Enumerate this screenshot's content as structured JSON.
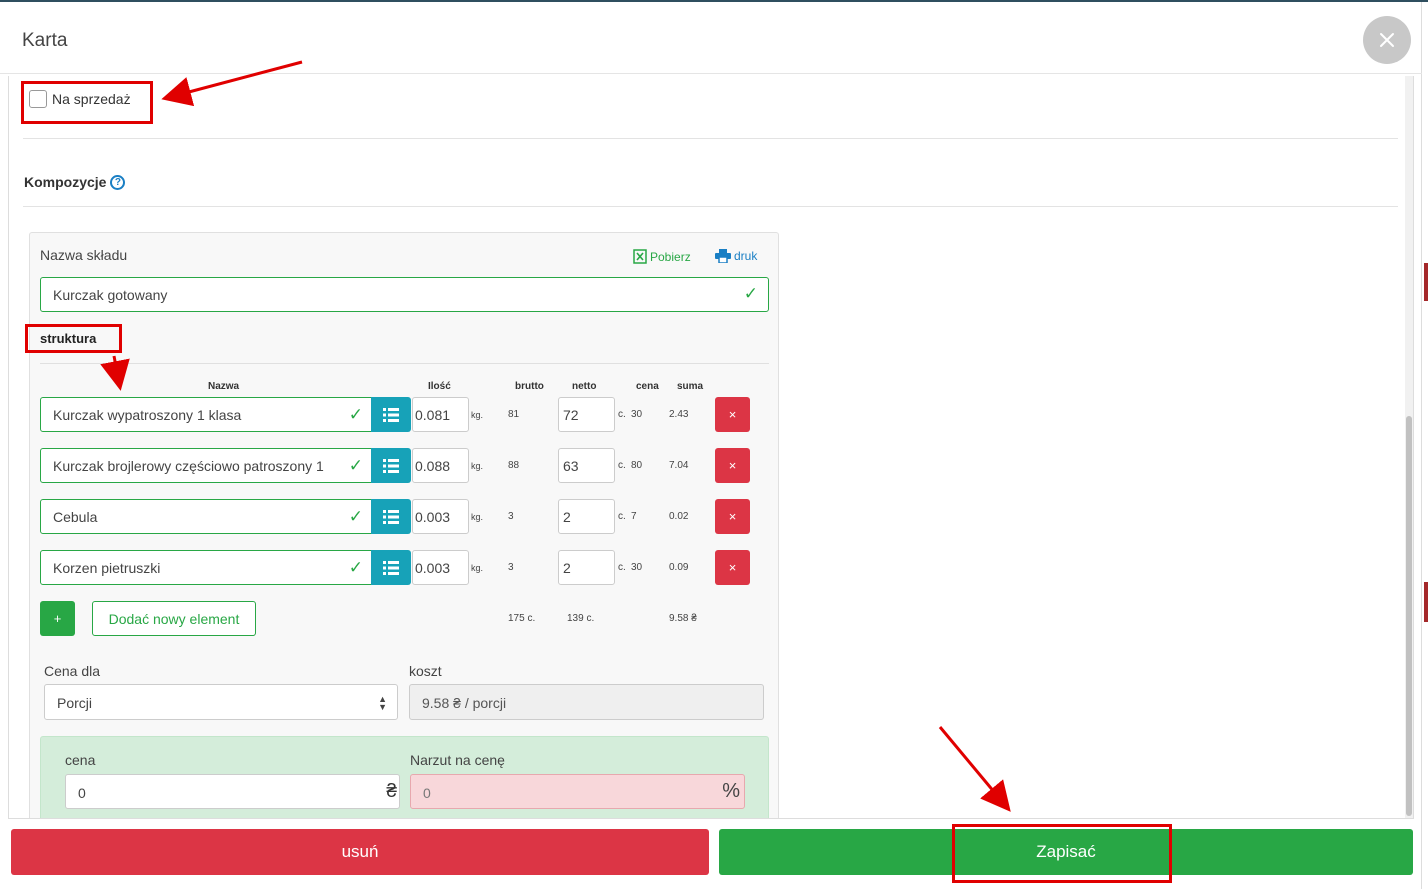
{
  "modal": {
    "title": "Karta"
  },
  "sale": {
    "label": "Na sprzedaż"
  },
  "composition": {
    "title": "Kompozycje",
    "help": "?",
    "name_label": "Nazwa składu",
    "download": "Pobierz",
    "print": "druk",
    "name_value": "Kurczak gotowany",
    "structure_label": "struktura",
    "columns": {
      "name": "Nazwa",
      "qty": "Ilość",
      "brutto": "brutto",
      "netto": "netto",
      "price": "cena",
      "sum": "suma"
    },
    "rows": [
      {
        "name": "Kurczak wypatroszony 1 klasa",
        "qty": "0.081",
        "unit": "kg.",
        "brutto": "81",
        "netto": "72",
        "netto_unit": "с.",
        "price": "30",
        "sum": "2.43"
      },
      {
        "name": "Kurczak brojlerowy częściowo patroszony 1",
        "qty": "0.088",
        "unit": "kg.",
        "brutto": "88",
        "netto": "63",
        "netto_unit": "с.",
        "price": "80",
        "sum": "7.04"
      },
      {
        "name": "Cebula",
        "qty": "0.003",
        "unit": "kg.",
        "brutto": "3",
        "netto": "2",
        "netto_unit": "с.",
        "price": "7",
        "sum": "0.02"
      },
      {
        "name": "Korzen pietruszki",
        "qty": "0.003",
        "unit": "kg.",
        "brutto": "3",
        "netto": "2",
        "netto_unit": "с.",
        "price": "30",
        "sum": "0.09"
      }
    ],
    "add_plus": "+",
    "add_new": "Dodać nowy element",
    "totals": {
      "brutto": "175 с.",
      "netto": "139 с.",
      "sum": "9.58 ₴"
    },
    "price_for_label": "Cena dla",
    "price_for_value": "Porcji",
    "cost_label": "koszt",
    "cost_value": "9.58 ₴ / porcji",
    "price_label": "cena",
    "price_value": "0",
    "currency": "₴",
    "markup_label": "Narzut na cenę",
    "markup_value": "0",
    "percent": "%"
  },
  "footer": {
    "delete": "usuń",
    "save": "Zapisać"
  },
  "colors": {
    "primary_green": "#28a745",
    "danger_red": "#dc3545",
    "info_teal": "#17a2b8",
    "annotation_red": "#e00000"
  }
}
